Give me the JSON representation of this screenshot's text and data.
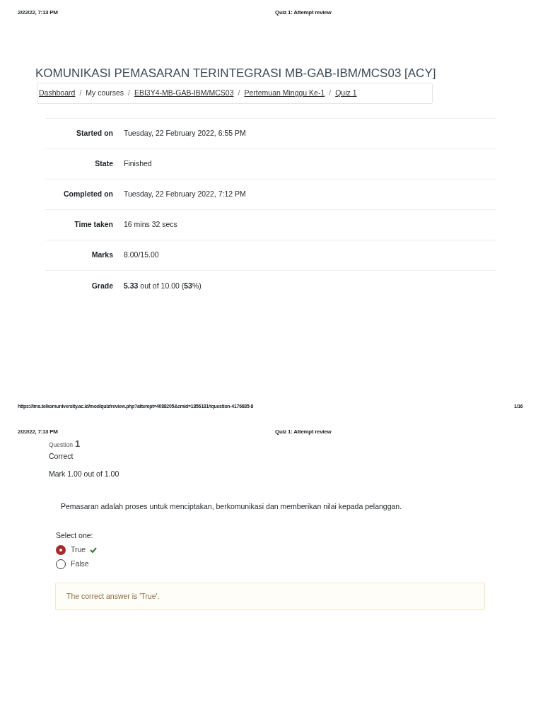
{
  "page1": {
    "header": {
      "date": "2/22/22, 7:13 PM",
      "title": "Quiz 1: Attempt review"
    },
    "course_title": "KOMUNIKASI PEMASARAN TERINTEGRASI MB-GAB-IBM/MCS03 [ACY]",
    "breadcrumb_separator": "/",
    "breadcrumb": [
      {
        "label": "Dashboard",
        "link": true
      },
      {
        "label": "My courses",
        "link": false
      },
      {
        "label": "EBI3Y4-MB-GAB-IBM/MCS03",
        "link": true
      },
      {
        "label": "Pertemuan Minggu Ke-1",
        "link": true
      },
      {
        "label": "Quiz 1",
        "link": true
      }
    ],
    "summary": [
      {
        "label": "Started on",
        "value": "Tuesday, 22 February 2022, 6:55 PM"
      },
      {
        "label": "State",
        "value": "Finished"
      },
      {
        "label": "Completed on",
        "value": "Tuesday, 22 February 2022, 7:12 PM"
      },
      {
        "label": "Time taken",
        "value": "16 mins 32 secs"
      },
      {
        "label": "Marks",
        "value": "8.00/15.00"
      },
      {
        "label": "Grade",
        "value": "**5.33** out of 10.00 (**53**%)"
      }
    ],
    "footer": {
      "url": "https://lms.telkomuniversity.ac.id/mod/quiz/review.php?attempt=4088205&cmid=1856181#question-4176685-8",
      "page": "1/16"
    }
  },
  "page2": {
    "header": {
      "date": "2/22/22, 7:13 PM",
      "title": "Quiz 1: Attempt review"
    },
    "question": {
      "label": "Question",
      "number": "1",
      "status": "Correct",
      "mark": "Mark 1.00 out of 1.00",
      "text": "Pemasaran adalah proses untuk menciptakan, berkomunikasi dan memberikan nilai kepada pelanggan.",
      "prompt": "Select one:",
      "options": [
        {
          "label": "True",
          "selected": true,
          "correct": true
        },
        {
          "label": "False",
          "selected": false,
          "correct": false
        }
      ],
      "feedback": "The correct answer is 'True'."
    }
  }
}
